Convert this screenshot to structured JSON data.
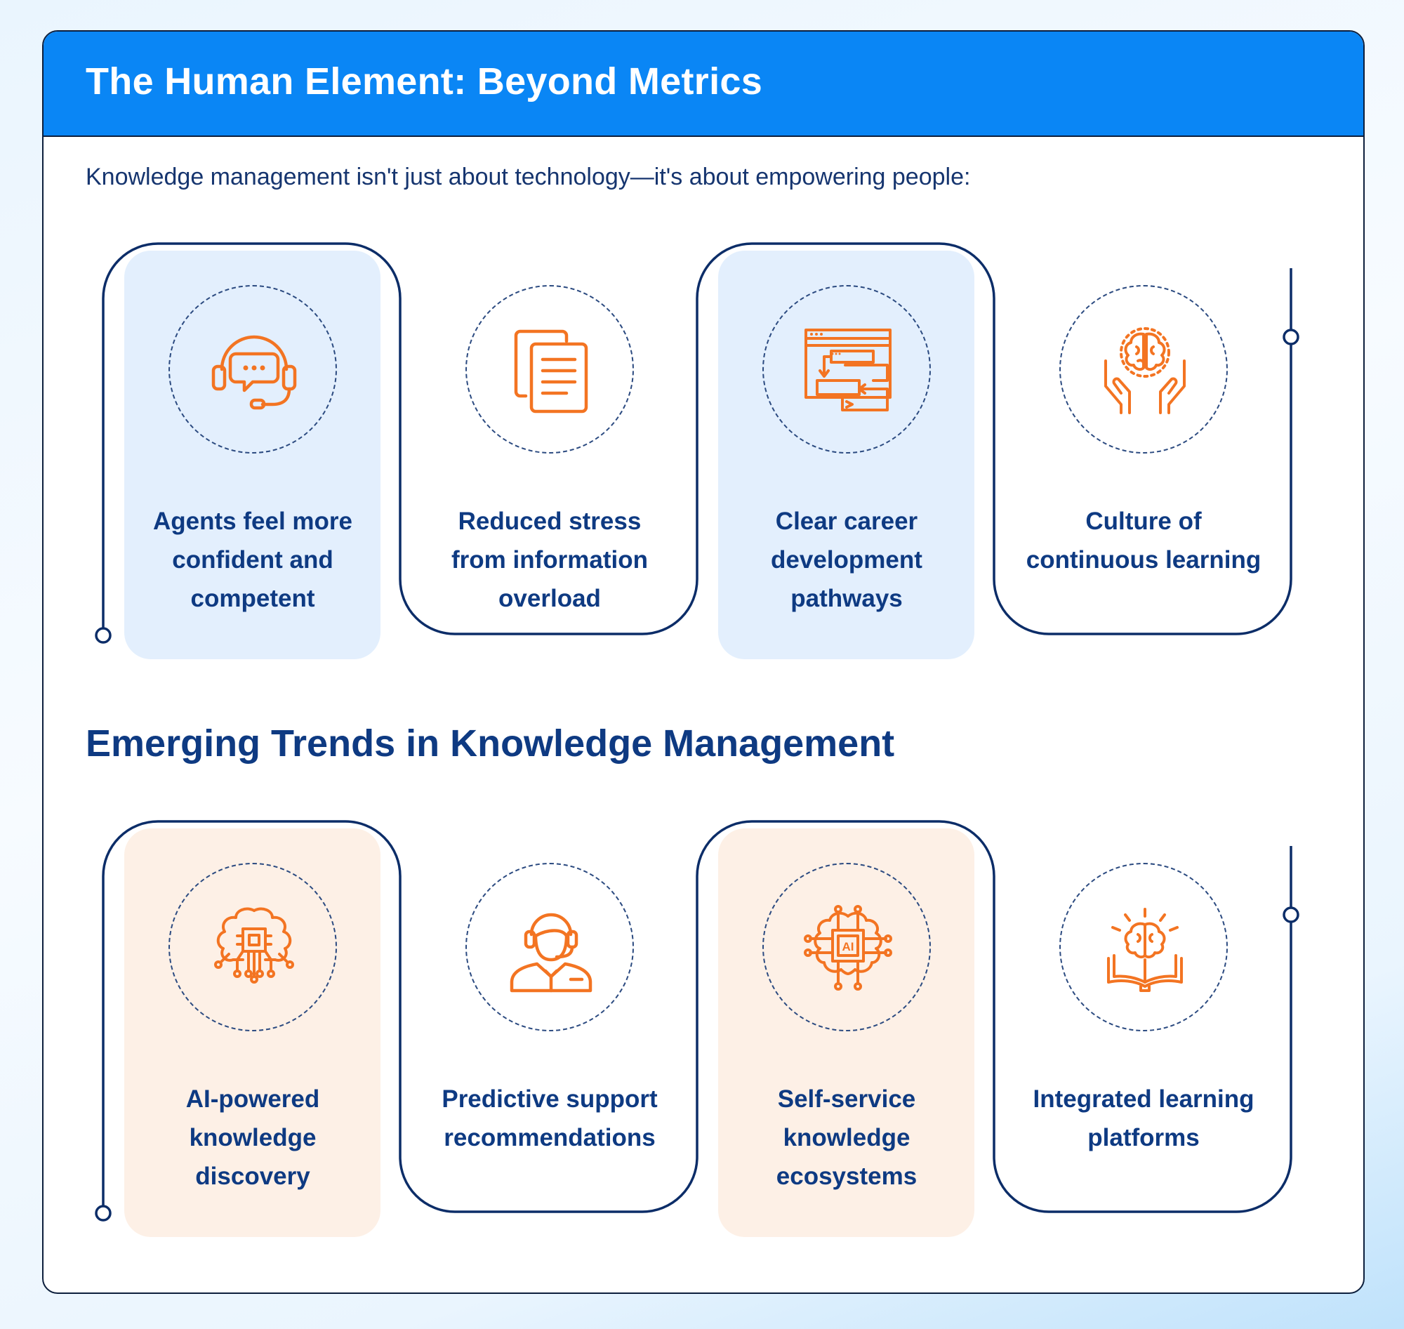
{
  "header": {
    "title": "The Human Element: Beyond Metrics"
  },
  "intro": "Knowledge management isn't just about technology—it's about empowering people:",
  "section2": {
    "heading": "Emerging Trends in Knowledge Management"
  },
  "human_items": [
    {
      "label": "Agents feel more confident and competent",
      "icon": "headset-chat-icon"
    },
    {
      "label": "Reduced stress from information overload",
      "icon": "documents-icon"
    },
    {
      "label": "Clear career development pathways",
      "icon": "workflow-window-icon"
    },
    {
      "label": "Culture of continuous learning",
      "icon": "brain-hands-icon"
    }
  ],
  "trend_items": [
    {
      "label": "AI-powered knowledge discovery",
      "icon": "brain-circuit-icon"
    },
    {
      "label": "Predictive support recommendations",
      "icon": "support-agent-icon"
    },
    {
      "label": "Self-service knowledge ecosystems",
      "icon": "ai-chip-icon"
    },
    {
      "label": "Integrated learning platforms",
      "icon": "brain-book-icon"
    }
  ],
  "ai_chip_text": "AI",
  "colors": {
    "header_blue": "#0a86f5",
    "navy": "#0e3a82",
    "icon_orange": "#f37422",
    "tile_blue": "#e3effd",
    "tile_peach": "#fdf0e6"
  }
}
